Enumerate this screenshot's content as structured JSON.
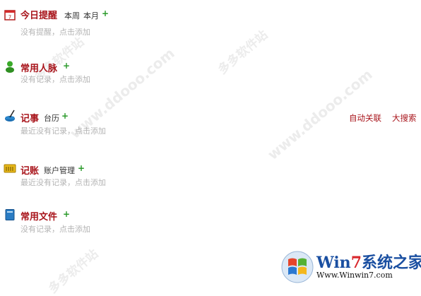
{
  "reminder": {
    "title": "今日提醒",
    "links": [
      "本周",
      "本月"
    ],
    "plus": "+",
    "empty": "没有提醒，点击添加"
  },
  "contacts": {
    "title": "常用人脉",
    "plus": "+",
    "empty": "没有记录，点击添加"
  },
  "notes": {
    "title": "记事",
    "links": [
      "台历"
    ],
    "plus": "+",
    "empty": "最近没有记录，点击添加",
    "right_links": [
      "自动关联",
      "大搜索"
    ]
  },
  "ledger": {
    "title": "记账",
    "links": [
      "账户管理"
    ],
    "plus": "+",
    "empty": "最近没有记录，点击添加"
  },
  "files": {
    "title": "常用文件",
    "plus": "+",
    "empty": "没有记录，点击添加"
  },
  "watermark": {
    "site": "www.ddooo.com",
    "cn": "多多软件站"
  },
  "logo": {
    "brand_win": "Win",
    "brand_7": "7",
    "brand_rest": "系统之家",
    "url": "Www.Winwin7.com"
  },
  "colors": {
    "title": "#a8141b",
    "plus": "#2a9a2a",
    "empty": "#b4b4b4"
  }
}
